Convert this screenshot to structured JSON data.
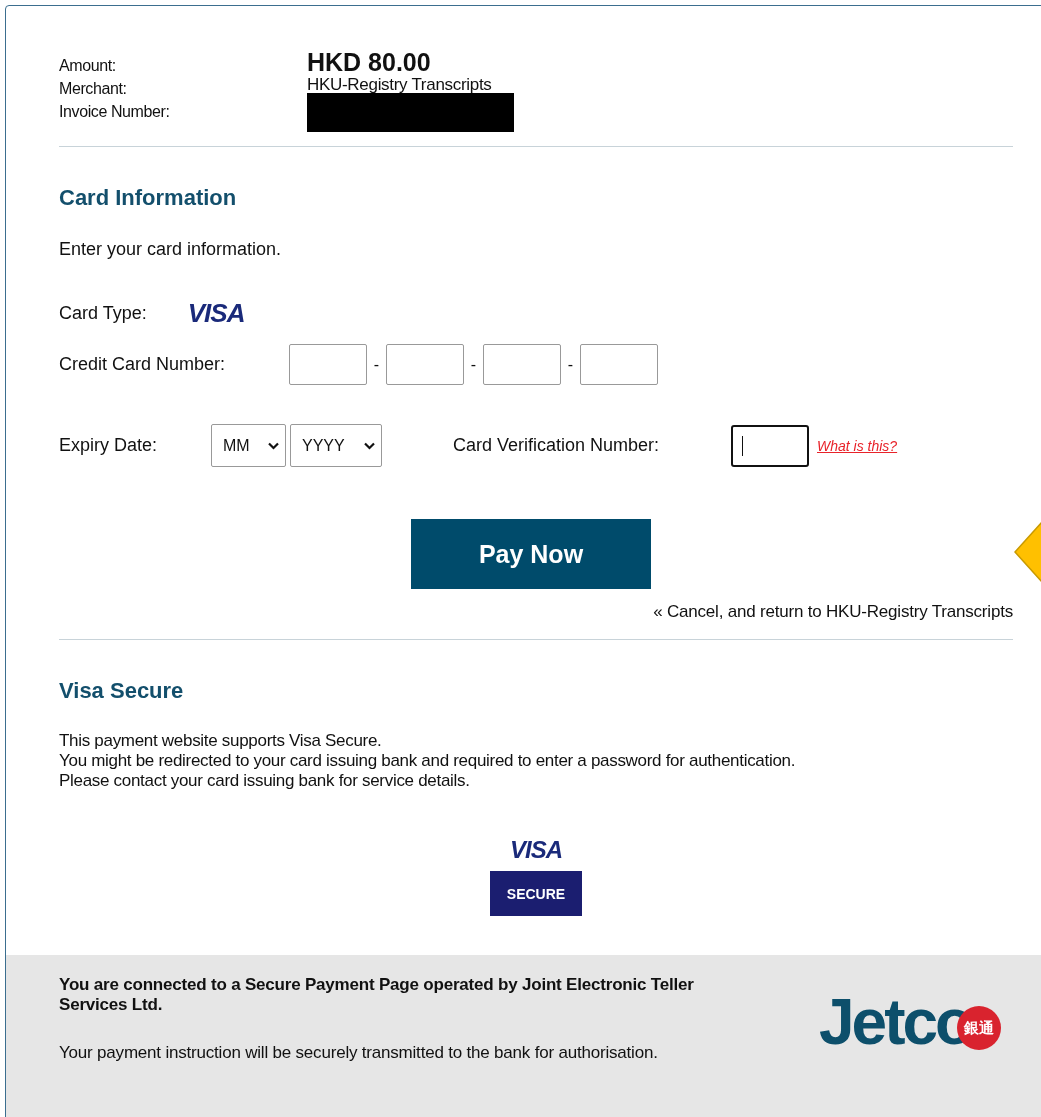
{
  "summary": {
    "amount_label": "Amount:",
    "amount": "HKD 80.00",
    "merchant_label": "Merchant:",
    "merchant": "HKU-Registry Transcripts",
    "invoice_label": "Invoice Number:"
  },
  "card_section": {
    "title": "Card Information",
    "intro": "Enter your card information.",
    "card_type_label": "Card Type:",
    "card_logo": "VISA",
    "card_number_label": "Credit Card Number:",
    "separators": [
      "-",
      "-",
      "-"
    ],
    "expiry_label": "Expiry Date:",
    "expiry_month": "MM",
    "expiry_year": "YYYY",
    "cvv_label": "Card Verification Number:",
    "cvv_focused": true,
    "help_link": "What is this?"
  },
  "pay_button": "Pay Now",
  "cancel_link": "« Cancel, and return to HKU-Registry Transcripts",
  "visa_secure": {
    "title": "Visa Secure",
    "lines": [
      "This payment website supports Visa Secure.",
      "You might be redirected to your card issuing bank and required to enter a password for authentication.",
      "Please contact your card issuing bank for service details."
    ],
    "logo_word": "VISA",
    "badge": "SECURE"
  },
  "footer": {
    "notice": "You are connected to a Secure Payment Page operated by Joint Electronic Teller Services Ltd.",
    "note": "Your payment instruction will be securely transmitted to the bank for authorisation.",
    "logo_word": "Jetco",
    "logo_badge": "銀通"
  }
}
